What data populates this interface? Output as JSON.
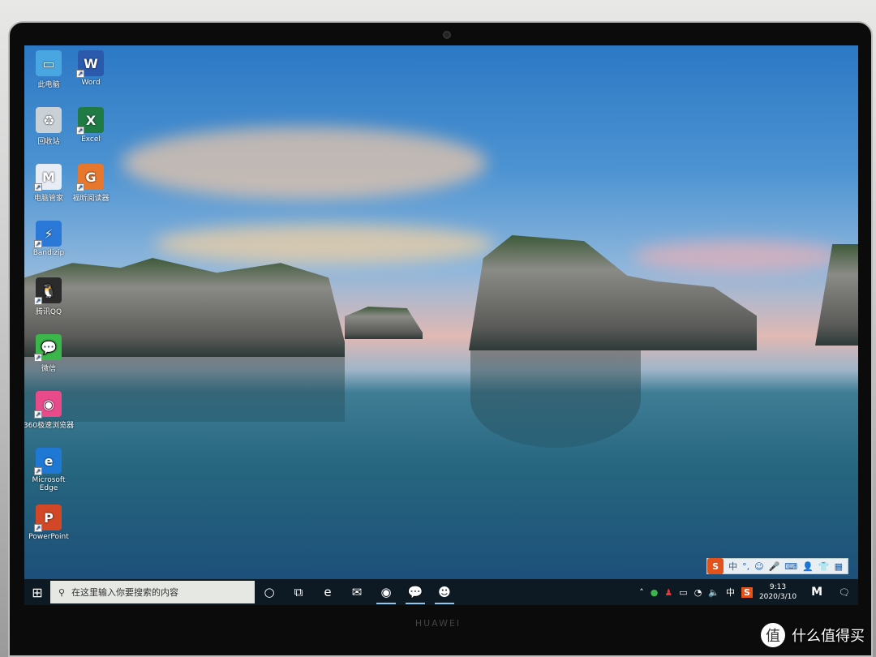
{
  "desktop_icons": [
    {
      "label": "此电脑",
      "icon": "computer-icon",
      "color": "#4aa6e0",
      "glyph": "▭"
    },
    {
      "label": "Word",
      "icon": "word-icon",
      "color": "#2b5aad",
      "glyph": "W"
    },
    {
      "label": "回收站",
      "icon": "recycle-bin-icon",
      "color": "#c9d1d6",
      "glyph": "♻"
    },
    {
      "label": "Excel",
      "icon": "excel-icon",
      "color": "#1f7a44",
      "glyph": "X"
    },
    {
      "label": "电脑管家",
      "icon": "pc-manager-icon",
      "color": "#e8edf5",
      "glyph": "M"
    },
    {
      "label": "福昕阅读器",
      "icon": "foxit-pdf-icon",
      "color": "#e8772e",
      "glyph": "G"
    },
    {
      "label": "Bandizip",
      "icon": "bandizip-icon",
      "color": "#2a79d8",
      "glyph": "⚡"
    },
    {
      "label": "腾讯QQ",
      "icon": "qq-icon",
      "color": "#2b2b2b",
      "glyph": "🐧"
    },
    {
      "label": "微信",
      "icon": "wechat-icon",
      "color": "#3bb64a",
      "glyph": "💬"
    },
    {
      "label": "360极速浏览器",
      "icon": "360-browser-icon",
      "color": "#e84a8a",
      "glyph": "◉"
    },
    {
      "label": "Microsoft Edge",
      "icon": "edge-icon",
      "color": "#1e78d4",
      "glyph": "e"
    },
    {
      "label": "PowerPoint",
      "icon": "powerpoint-icon",
      "color": "#d24726",
      "glyph": "P"
    }
  ],
  "taskbar": {
    "search_placeholder": "在这里输入你要搜索的内容",
    "apps": [
      {
        "name": "cortana",
        "glyph": "○",
        "running": false
      },
      {
        "name": "task-view",
        "glyph": "⧉",
        "running": false
      },
      {
        "name": "edge",
        "glyph": "e",
        "running": false
      },
      {
        "name": "mail",
        "glyph": "✉",
        "running": false
      },
      {
        "name": "360-browser",
        "glyph": "◉",
        "running": true
      },
      {
        "name": "wechat",
        "glyph": "💬",
        "running": true
      },
      {
        "name": "avatar-app",
        "glyph": "☻",
        "running": true
      }
    ],
    "tray": {
      "ime_lang": "中",
      "sogou": "S",
      "time": "9:13",
      "date": "2020/3/10",
      "pc_manager": "M"
    }
  },
  "ime_toolbar": {
    "logo": "S",
    "mode": "中",
    "punct": "°,",
    "items": [
      "☺",
      "🎤",
      "⌨",
      "👤",
      "👕",
      "▦"
    ]
  },
  "laptop_brand": "HUAWEI",
  "watermark": {
    "logo": "值",
    "text": "什么值得买"
  }
}
